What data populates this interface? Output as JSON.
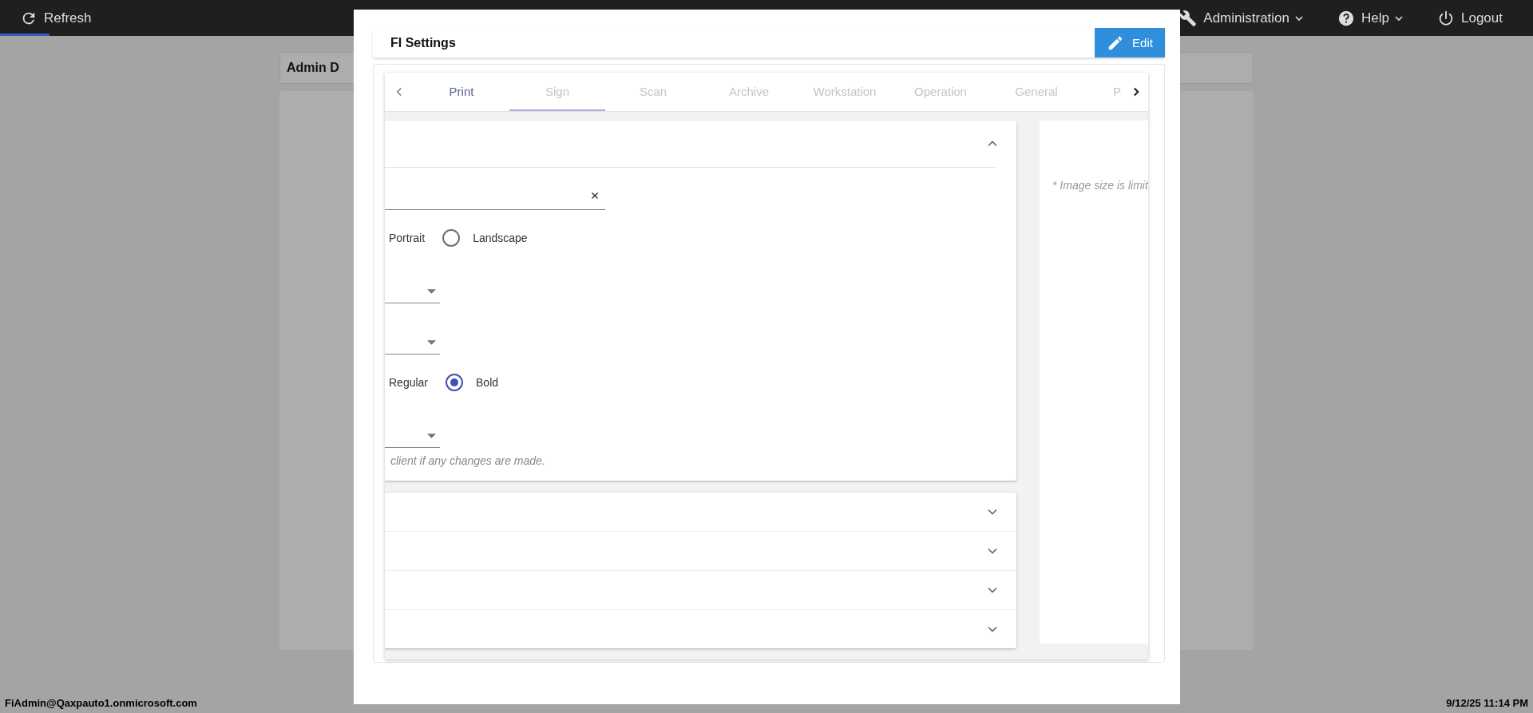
{
  "top_bar": {
    "refresh": "Refresh",
    "menus": [
      {
        "label": "Administration",
        "dropdown": true
      },
      {
        "label": "Help",
        "dropdown": true
      },
      {
        "label": "Logout",
        "dropdown": false
      }
    ]
  },
  "background": {
    "card_title": "Admin D"
  },
  "dialog": {
    "title": "FI Settings",
    "edit_button": "Edit",
    "tabs": [
      {
        "label": "Print",
        "selected": true,
        "underlined": false
      },
      {
        "label": "Sign",
        "selected": false,
        "underlined": true
      },
      {
        "label": "Scan",
        "selected": false,
        "underlined": false
      },
      {
        "label": "Archive",
        "selected": false,
        "underlined": false
      },
      {
        "label": "Workstation",
        "selected": false,
        "underlined": false
      },
      {
        "label": "Operation",
        "selected": false,
        "underlined": false
      },
      {
        "label": "General",
        "selected": false,
        "underlined": false
      },
      {
        "label": "P",
        "selected": false,
        "underlined": false
      }
    ],
    "expanded_section": {
      "expanded": true,
      "rows": [
        {
          "kind": "text",
          "clearable": true
        },
        {
          "kind": "radio",
          "left_label": "Portrait",
          "option": {
            "label": "Landscape",
            "selected": false
          }
        },
        {
          "kind": "select"
        },
        {
          "kind": "select"
        },
        {
          "kind": "radio",
          "left_label": "Regular",
          "option": {
            "label": "Bold",
            "selected": true
          }
        },
        {
          "kind": "select"
        },
        {
          "kind": "note",
          "text": "client if any changes are made."
        }
      ]
    },
    "collapsed_sections": [
      {
        "expanded": false
      },
      {
        "expanded": false
      },
      {
        "expanded": false
      },
      {
        "expanded": false
      }
    ],
    "side_panel": {
      "note": "* Image size is limit"
    }
  },
  "status_bar": {
    "user": "FiAdmin@Qaxpauto1.onmicrosoft.com",
    "datetime": "9/12/25 11:14 PM"
  }
}
